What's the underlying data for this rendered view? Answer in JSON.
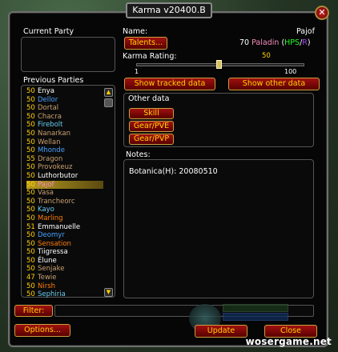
{
  "window": {
    "title": "Karma v20400.B",
    "close": "✕"
  },
  "current_party": {
    "label": "Current Party"
  },
  "previous_parties": {
    "label": "Previous Parties",
    "items": [
      {
        "level": "50",
        "name": "Enya",
        "color": "#ffffff"
      },
      {
        "level": "50",
        "name": "Dellor",
        "color": "#4aa0ff"
      },
      {
        "level": "50",
        "name": "Dortal",
        "color": "#c8a070"
      },
      {
        "level": "50",
        "name": "Chacra",
        "color": "#c8a070"
      },
      {
        "level": "50",
        "name": "Firebolt",
        "color": "#69ccf0"
      },
      {
        "level": "50",
        "name": "Nanarkan",
        "color": "#c8a070"
      },
      {
        "level": "50",
        "name": "Wellan",
        "color": "#c8a070"
      },
      {
        "level": "50",
        "name": "Mhonde",
        "color": "#4aa0ff"
      },
      {
        "level": "55",
        "name": "Dragon",
        "color": "#c8a070"
      },
      {
        "level": "50",
        "name": "Provokeuz",
        "color": "#c8a070"
      },
      {
        "level": "50",
        "name": "Luthorbutor",
        "color": "#ffffff"
      },
      {
        "level": "50",
        "name": "Pajof",
        "color": "#f58cba"
      },
      {
        "level": "50",
        "name": "Vasa",
        "color": "#c8a070"
      },
      {
        "level": "50",
        "name": "Trancheorc",
        "color": "#c8a070"
      },
      {
        "level": "50",
        "name": "Kayo",
        "color": "#69ccf0"
      },
      {
        "level": "50",
        "name": "Marling",
        "color": "#ff7d0a"
      },
      {
        "level": "51",
        "name": "Emmanuelle",
        "color": "#ffffff"
      },
      {
        "level": "50",
        "name": "Deomyr",
        "color": "#4aa0ff"
      },
      {
        "level": "50",
        "name": "Sensation",
        "color": "#ff7d0a"
      },
      {
        "level": "50",
        "name": "Tiigressa",
        "color": "#ffffff"
      },
      {
        "level": "50",
        "name": "Élune",
        "color": "#ffffff"
      },
      {
        "level": "50",
        "name": "Senjake",
        "color": "#c8a070"
      },
      {
        "level": "47",
        "name": "Tewie",
        "color": "#c8a070"
      },
      {
        "level": "50",
        "name": "Nirsh",
        "color": "#ff7d0a"
      },
      {
        "level": "50",
        "name": "Sephiria",
        "color": "#69ccf0"
      }
    ],
    "selected_index": 11
  },
  "detail": {
    "name_label": "Name:",
    "name_value": "Pajof",
    "talents_button": "Talents...",
    "level_class_prefix": "70",
    "class_name": "Paladin",
    "role_open": "(",
    "role_hps": "HPS",
    "role_sep": "/",
    "role_r": "R",
    "role_close": ")",
    "karma_label": "Karma Rating:",
    "karma_value": "50",
    "karma_min": "1",
    "karma_max": "100",
    "karma_fraction": 0.49,
    "show_tracked_button": "Show tracked data",
    "show_other_button": "Show other data",
    "other_data_label": "Other data",
    "skill_button": "Skill",
    "gear_pve_button": "Gear/PVE",
    "gear_pvp_button": "Gear/PVP",
    "notes_label": "Notes:",
    "notes_text": "Botanica(H): 20080510"
  },
  "filter": {
    "button": "Filter:",
    "value": ""
  },
  "footer": {
    "options_button": "Options...",
    "update_button": "Update",
    "close_button": "Close"
  },
  "watermark": "wosergame.net",
  "colors": {
    "gold": "#ffd100",
    "paladin_pink": "#f58cba",
    "hps_green": "#20ff20",
    "r_purple": "#a040ff",
    "button_red": "#8a0a0a"
  }
}
